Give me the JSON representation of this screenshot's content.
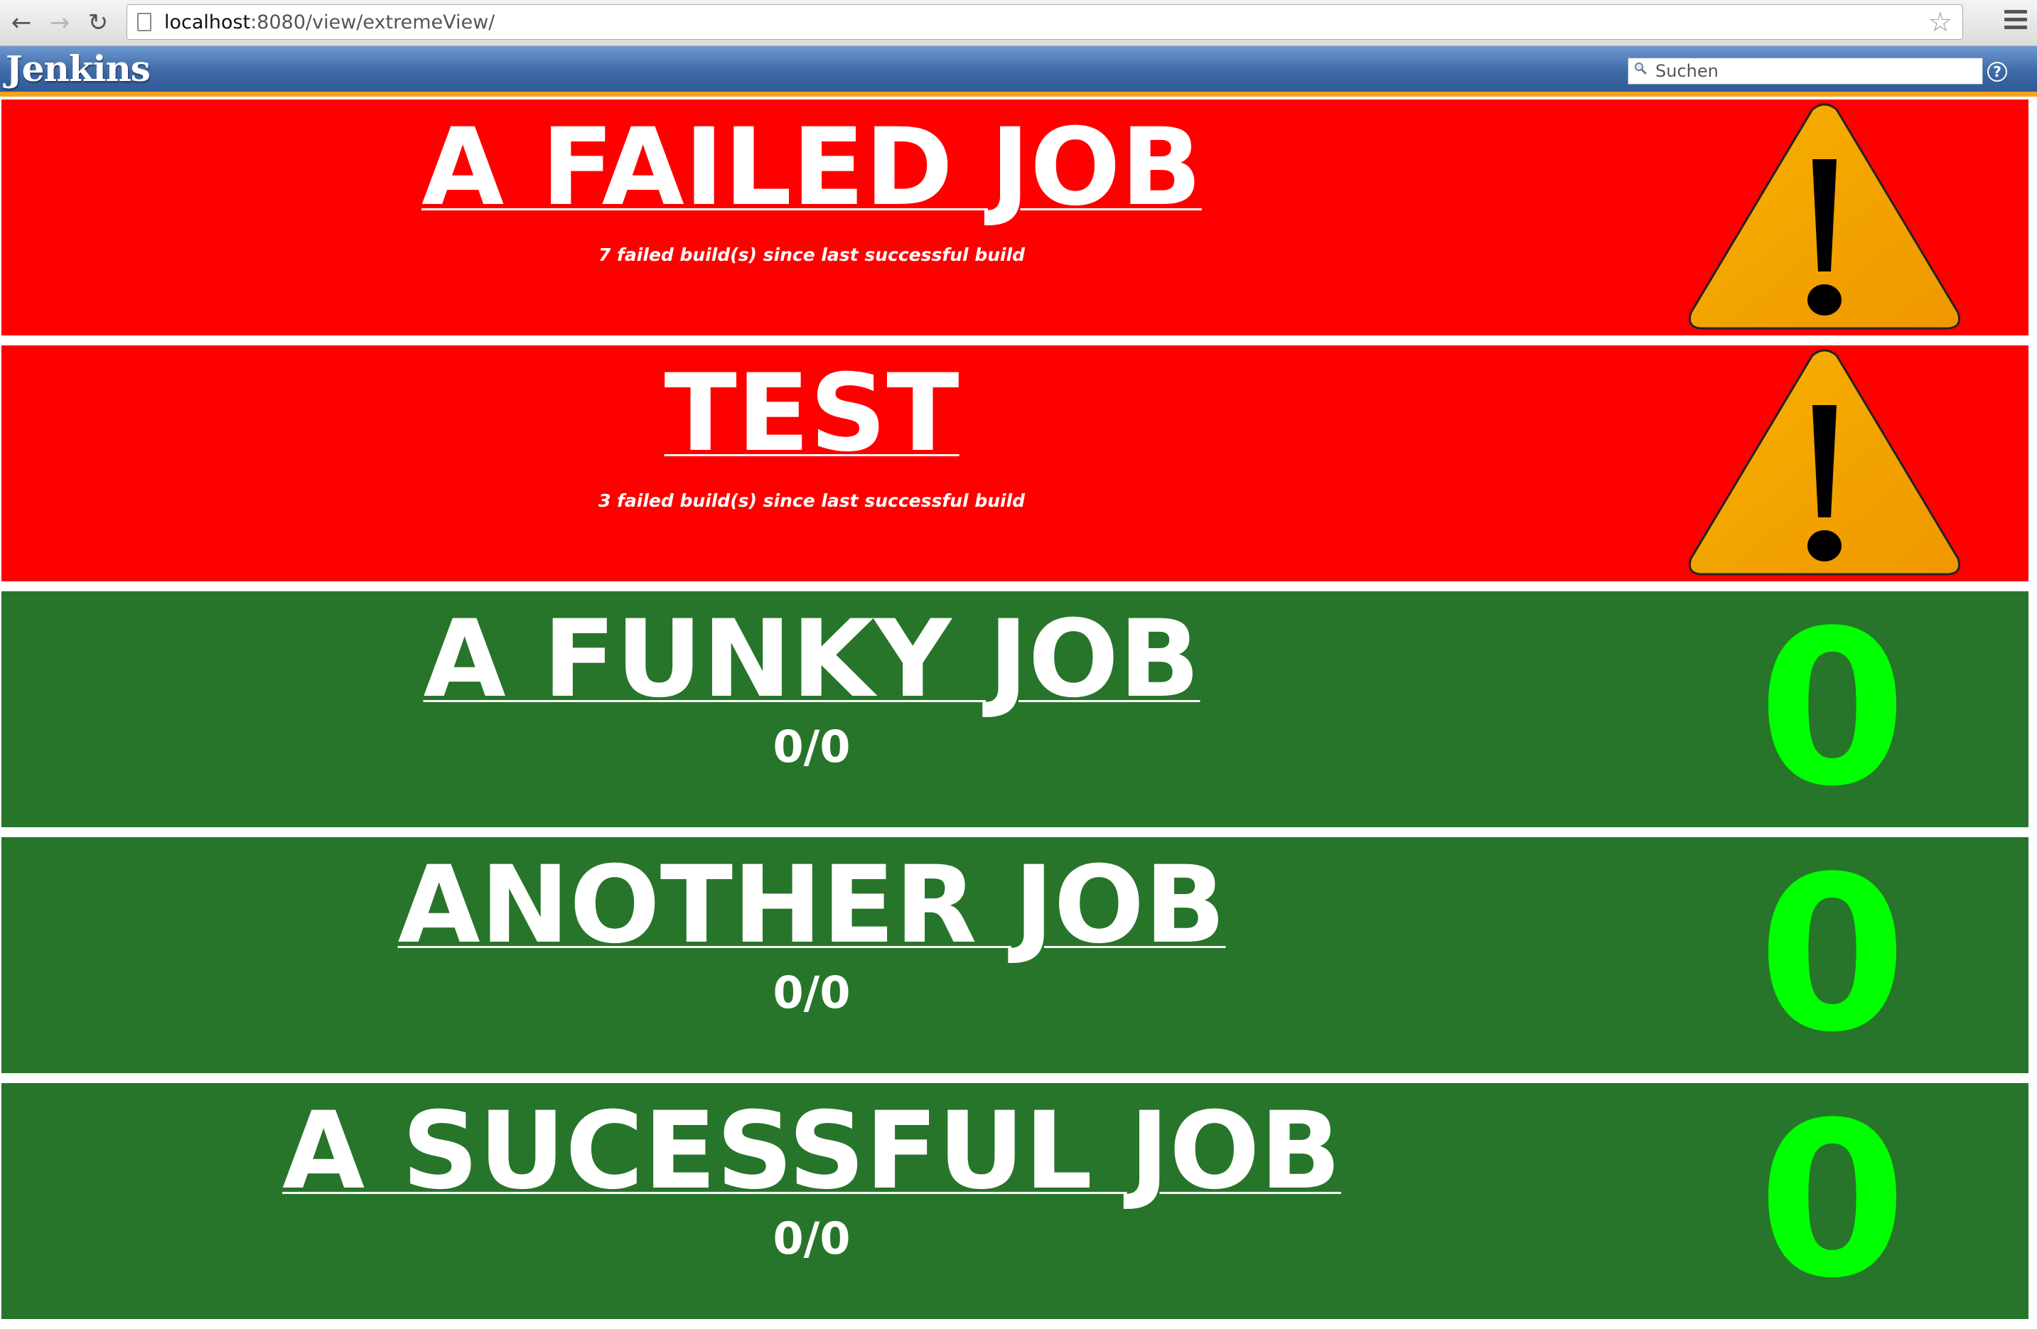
{
  "browser": {
    "url_host": "localhost",
    "url_path": ":8080/view/extremeView/",
    "back_icon": "←",
    "forward_icon": "→",
    "reload_icon": "↻",
    "star_icon": "☆"
  },
  "jenkins": {
    "logo": "Jenkins",
    "search_placeholder": "Suchen",
    "help_icon": "?",
    "header_color": "#3e6aa8",
    "accent_color": "#f7a21b"
  },
  "colors": {
    "failed": "#ff0000",
    "success": "#27752a",
    "count": "#00ff00",
    "warning": "#f2a200"
  },
  "jobs": [
    {
      "name": "A FAILED JOB",
      "status": "failed",
      "detail": "7 failed build(s) since last successful build",
      "icon": "warning-icon"
    },
    {
      "name": "TEST",
      "status": "failed",
      "detail": "3 failed build(s) since last successful build",
      "icon": "warning-icon"
    },
    {
      "name": "A FUNKY JOB",
      "status": "success",
      "detail": "0/0",
      "count": "0"
    },
    {
      "name": "ANOTHER JOB",
      "status": "success",
      "detail": "0/0",
      "count": "0"
    },
    {
      "name": "A SUCESSFUL JOB",
      "status": "success",
      "detail": "0/0",
      "count": "0"
    }
  ]
}
